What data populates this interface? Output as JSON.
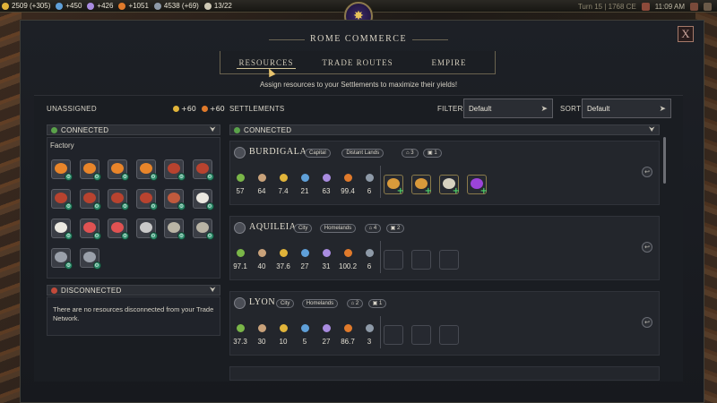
{
  "topbar": {
    "resources": [
      {
        "icon": "gold-coin-icon",
        "color": "#e1b43a",
        "text": "2509 (+305)"
      },
      {
        "icon": "flask-science-icon",
        "color": "#5fa0d9",
        "text": "+450"
      },
      {
        "icon": "music-note-icon",
        "color": "#a98ce0",
        "text": "+426"
      },
      {
        "icon": "happiness-face-icon",
        "color": "#e07a2b",
        "text": "+1051"
      },
      {
        "icon": "population-icon",
        "color": "#8e9aa8",
        "text": "4538 (+69)"
      },
      {
        "icon": "settlements-icon",
        "color": "#cfc9b5",
        "text": "13/22"
      }
    ],
    "turn": "Turn 15 | 1768 CE",
    "clock": "11:09 AM"
  },
  "dialog": {
    "title": "ROME COMMERCE",
    "close_label": "X",
    "tabs": [
      {
        "label": "RESOURCES",
        "active": true
      },
      {
        "label": "TRADE ROUTES",
        "active": false
      },
      {
        "label": "EMPIRE",
        "active": false
      }
    ],
    "subtitle": "Assign resources to your Settlements to maximize their yields!"
  },
  "unassigned": {
    "header": "UNASSIGNED",
    "gold": "+60",
    "happiness": "+60",
    "connected_label": "CONNECTED",
    "category": "Factory",
    "resources": [
      {
        "icon": "citrus-resource-icon",
        "color": "#e9852a"
      },
      {
        "icon": "citrus-resource-icon",
        "color": "#e9852a"
      },
      {
        "icon": "citrus-resource-icon",
        "color": "#e9852a"
      },
      {
        "icon": "citrus-resource-icon",
        "color": "#e9852a"
      },
      {
        "icon": "dyes-resource-icon",
        "color": "#b8432f"
      },
      {
        "icon": "dyes-resource-icon",
        "color": "#b8432f"
      },
      {
        "icon": "dyes-resource-icon",
        "color": "#b8432f"
      },
      {
        "icon": "dyes-resource-icon",
        "color": "#b8432f"
      },
      {
        "icon": "dyes-resource-icon",
        "color": "#b8432f"
      },
      {
        "icon": "dyes-resource-icon",
        "color": "#b8432f"
      },
      {
        "icon": "mixed-resource-icon",
        "color": "#c05a3d"
      },
      {
        "icon": "cotton-resource-icon",
        "color": "#ebe8e0"
      },
      {
        "icon": "cotton-resource-icon",
        "color": "#ebe8e0"
      },
      {
        "icon": "salt-resource-icon",
        "color": "#e05252"
      },
      {
        "icon": "salt-resource-icon",
        "color": "#e05252"
      },
      {
        "icon": "silver-resource-icon",
        "color": "#c9c9c9"
      },
      {
        "icon": "hides-resource-icon",
        "color": "#b9b4a5"
      },
      {
        "icon": "hides-resource-icon",
        "color": "#b9b4a5"
      },
      {
        "icon": "tin-resource-icon",
        "color": "#9aa0aa"
      },
      {
        "icon": "tin-resource-icon",
        "color": "#9aa0aa"
      }
    ],
    "disconnected_label": "DISCONNECTED",
    "disconnected_text": "There are no resources disconnected from your Trade Network."
  },
  "settlements": {
    "header": "SETTLEMENTS",
    "filter_label": "FILTER",
    "filter_value": "Default",
    "sort_label": "SORT",
    "sort_value": "Default",
    "connected_label": "CONNECTED",
    "cards": [
      {
        "name": "BURDIGALA",
        "tags": [
          "Capital",
          "Distant Lands"
        ],
        "pop": "3",
        "buildings": "1",
        "yields": [
          "57",
          "64",
          "7.4",
          "21",
          "63",
          "99.4",
          "6"
        ],
        "slots": [
          {
            "icon": "horse-resource-icon",
            "color": "#d99a3b",
            "badge": "+"
          },
          {
            "icon": "horse-resource-icon",
            "color": "#d99a3b",
            "badge": "+"
          },
          {
            "icon": "truffle-resource-icon",
            "color": "#d6d1c0",
            "badge": "+"
          },
          {
            "icon": "grapes-resource-icon",
            "color": "#9b44d8",
            "badge": "+"
          }
        ]
      },
      {
        "name": "AQUILEIA",
        "tags": [
          "City",
          "Homelands"
        ],
        "pop": "4",
        "buildings": "2",
        "yields": [
          "97.1",
          "40",
          "37.6",
          "27",
          "31",
          "100.2",
          "6"
        ],
        "slots": []
      },
      {
        "name": "LYON",
        "tags": [
          "City",
          "Homelands"
        ],
        "pop": "2",
        "buildings": "1",
        "yields": [
          "37.3",
          "30",
          "10",
          "5",
          "27",
          "86.7",
          "3"
        ],
        "slots": []
      }
    ],
    "yield_icons": [
      {
        "icon": "food-icon",
        "color": "#7ab648"
      },
      {
        "icon": "industry-hammer-icon",
        "color": "#c9a27a"
      },
      {
        "icon": "gold-coin-icon",
        "color": "#e1b43a"
      },
      {
        "icon": "flask-science-icon",
        "color": "#5fa0d9"
      },
      {
        "icon": "music-note-icon",
        "color": "#a98ce0"
      },
      {
        "icon": "happiness-face-icon",
        "color": "#e07a2b"
      },
      {
        "icon": "influence-icon",
        "color": "#8e9aa8"
      }
    ]
  }
}
